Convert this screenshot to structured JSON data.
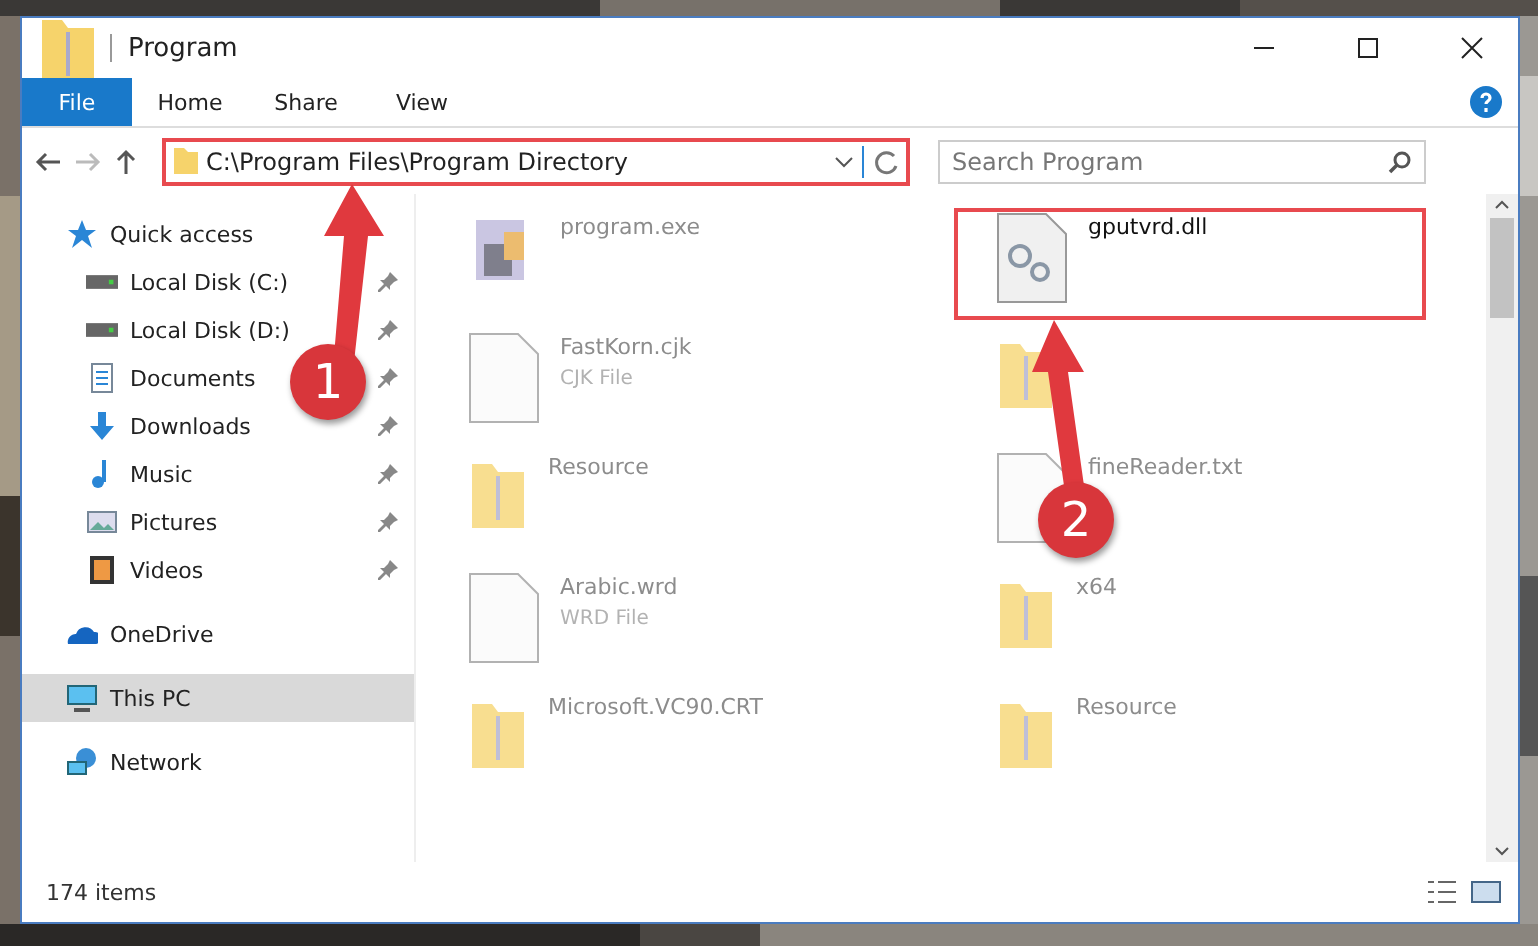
{
  "window": {
    "title": "Program"
  },
  "ribbon_tabs": [
    {
      "label": "File",
      "selected": true
    },
    {
      "label": "Home",
      "selected": false
    },
    {
      "label": "Share",
      "selected": false
    },
    {
      "label": "View",
      "selected": false
    }
  ],
  "address": {
    "path": "C:\\Program Files\\Program Directory"
  },
  "search": {
    "placeholder": "Search Program"
  },
  "nav": [
    {
      "label": "Quick access",
      "kind": "star",
      "selected": false,
      "children": [
        {
          "label": "Local Disk (C:)",
          "kind": "drive",
          "pinned": true
        },
        {
          "label": "Local Disk (D:)",
          "kind": "drive",
          "pinned": true
        },
        {
          "label": "Documents",
          "kind": "documents",
          "pinned": true
        },
        {
          "label": "Downloads",
          "kind": "downloads",
          "pinned": true
        },
        {
          "label": "Music",
          "kind": "music",
          "pinned": true
        },
        {
          "label": "Pictures",
          "kind": "pictures",
          "pinned": true
        },
        {
          "label": "Videos",
          "kind": "videos",
          "pinned": true
        }
      ]
    },
    {
      "label": "OneDrive",
      "kind": "cloud",
      "selected": false
    },
    {
      "label": "This PC",
      "kind": "pc",
      "selected": true
    },
    {
      "label": "Network",
      "kind": "network",
      "selected": false
    }
  ],
  "files": [
    {
      "name": "program.exe",
      "kind": "exe",
      "blurred": true
    },
    {
      "name": "gputvrd.dll",
      "kind": "dll",
      "blurred": false
    },
    {
      "name": "FastKorn.cjk",
      "type": "CJK File",
      "kind": "file",
      "blurred": true
    },
    {
      "kind": "folder",
      "blurred": true
    },
    {
      "name": "Resource",
      "kind": "folder",
      "blurred": true
    },
    {
      "name": "fineReader.txt",
      "kind": "file",
      "blurred": true
    },
    {
      "name": "Arabic.wrd",
      "type": "WRD File",
      "kind": "file",
      "blurred": true
    },
    {
      "name": "x64",
      "kind": "folder",
      "blurred": true
    },
    {
      "name": "Microsoft.VC90.CRT",
      "kind": "folder",
      "blurred": true
    },
    {
      "name": "Resource",
      "kind": "folder",
      "blurred": true
    }
  ],
  "status_bar": {
    "count": "174 items"
  },
  "annotations": [
    {
      "label": "1"
    },
    {
      "label": "2"
    }
  ]
}
